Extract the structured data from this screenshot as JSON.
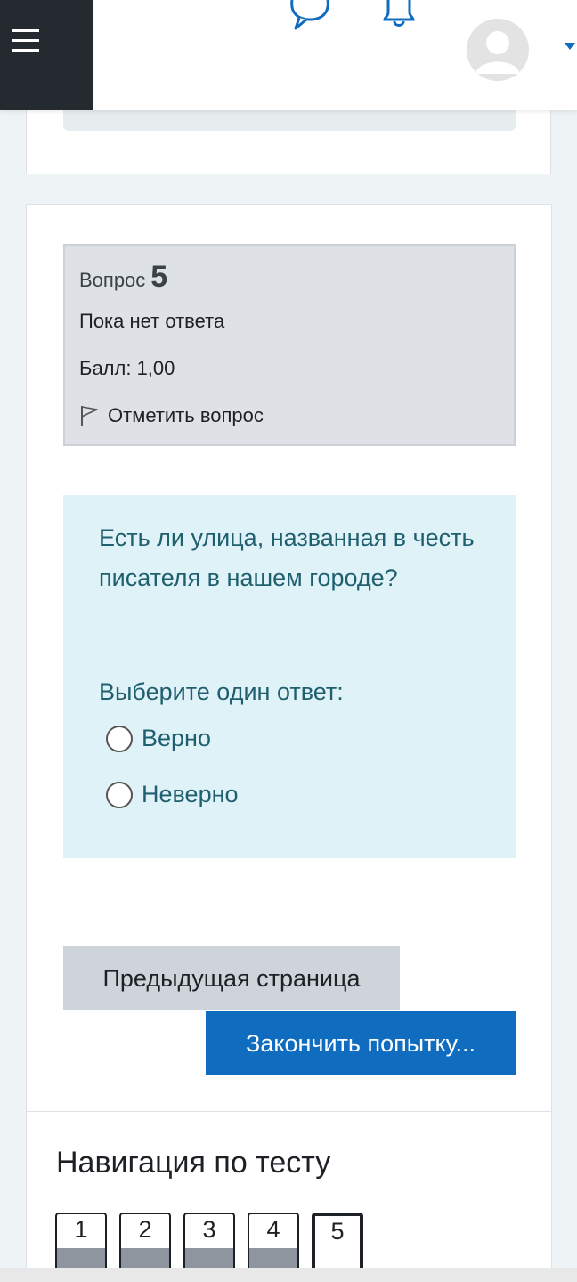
{
  "question": {
    "label": "Вопрос",
    "number": "5",
    "state": "Пока нет ответа",
    "grade": "Балл: 1,00",
    "flag_label": "Отметить вопрос",
    "text": "Есть ли улица, названная в честь писателя в нашем городе?",
    "prompt": "Выберите один ответ:",
    "options": [
      {
        "label": "Верно"
      },
      {
        "label": "Неверно"
      }
    ]
  },
  "buttons": {
    "prev": "Предыдущая страница",
    "finish": "Закончить попытку..."
  },
  "quiz_nav": {
    "title": "Навигация по тесту",
    "items": [
      {
        "label": "1"
      },
      {
        "label": "2"
      },
      {
        "label": "3"
      },
      {
        "label": "4"
      },
      {
        "label": "5"
      }
    ]
  },
  "colors": {
    "accent": "#0f6cbf",
    "navbar_dark": "#252a30",
    "question_content_bg": "#def2f8",
    "question_text": "#1f5f6e"
  },
  "icons": {
    "menu": "hamburger-icon",
    "messages": "chat-icon",
    "notifications": "bell-icon",
    "user": "avatar",
    "user_menu": "caret-down-icon",
    "flag": "flag-icon"
  }
}
